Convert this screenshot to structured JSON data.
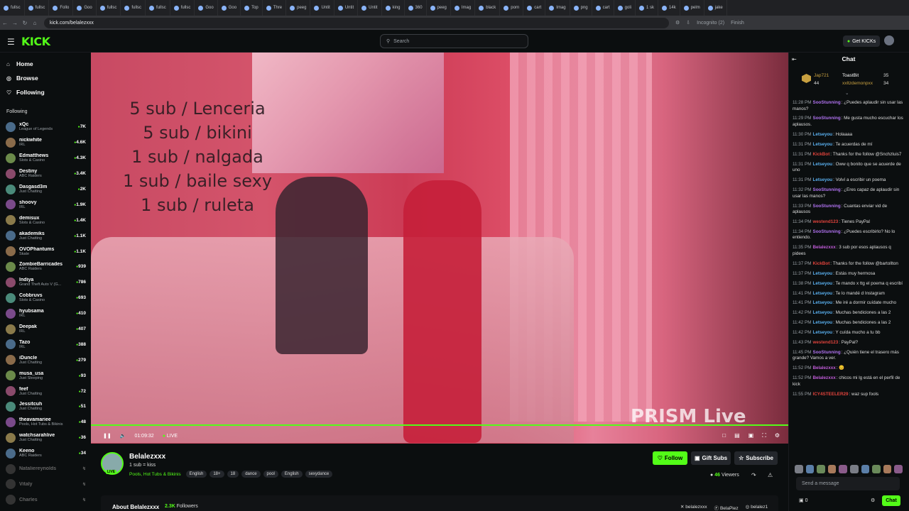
{
  "browser": {
    "tabs": [
      "fullsc",
      "fullsc",
      "Follo",
      "Goo",
      "fullsc",
      "fullsc",
      "fullsc",
      "fullsc",
      "Goo",
      "Goo",
      "Top",
      "Thre",
      "peeg",
      "Untit",
      "Untit",
      "Untit",
      "king",
      "360",
      "peeg",
      "Imag",
      "black",
      "porn",
      "cart",
      "Imag",
      "png",
      "cart",
      "goli",
      "1 sk",
      "14k",
      "pelm",
      "jake"
    ],
    "url": "kick.com/belalezxxx",
    "incognito": "Incognito (2)",
    "finish": "Finish"
  },
  "header": {
    "logo": "KICK",
    "search_placeholder": "Search",
    "get_kicks": "Get KICKs"
  },
  "sidebar": {
    "nav": [
      {
        "label": "Home",
        "icon": "home-icon"
      },
      {
        "label": "Browse",
        "icon": "compass-icon"
      },
      {
        "label": "Following",
        "icon": "heart-icon"
      }
    ],
    "following_label": "Following",
    "channels": [
      {
        "name": "xQc",
        "category": "League of Legends",
        "viewers": "7K"
      },
      {
        "name": "nickwhite",
        "category": "IRL",
        "viewers": "4.6K"
      },
      {
        "name": "Edmatthews",
        "category": "Slots & Casino",
        "viewers": "4.3K"
      },
      {
        "name": "Destiny",
        "category": "ABC Raiders",
        "viewers": "3.4K"
      },
      {
        "name": "Dasgasd3m",
        "category": "Just Chatting",
        "viewers": "2K"
      },
      {
        "name": "shoovy",
        "category": "IRL",
        "viewers": "1.9K"
      },
      {
        "name": "demisux",
        "category": "Slots & Casino",
        "viewers": "1.4K"
      },
      {
        "name": "akademiks",
        "category": "Just Chatting",
        "viewers": "1.1K"
      },
      {
        "name": "OVOPhantums",
        "category": "Skate",
        "viewers": "1.1K"
      },
      {
        "name": "ZombieBarricades",
        "category": "ABC Raiders",
        "viewers": "939"
      },
      {
        "name": "Indiya",
        "category": "Grand Theft Auto V (G...",
        "viewers": "786"
      },
      {
        "name": "Cobbruvs",
        "category": "Slots & Casino",
        "viewers": "693"
      },
      {
        "name": "hyubsama",
        "category": "IRL",
        "viewers": "410"
      },
      {
        "name": "Deepak",
        "category": "IRL",
        "viewers": "407"
      },
      {
        "name": "Tazo",
        "category": "IRL",
        "viewers": "388"
      },
      {
        "name": "iDuncle",
        "category": "Just Chatting",
        "viewers": "279"
      },
      {
        "name": "musa_usa",
        "category": "Just Sleeping",
        "viewers": "93"
      },
      {
        "name": "feef",
        "category": "Just Chatting",
        "viewers": "72"
      },
      {
        "name": "Jessitcuh",
        "category": "Just Chatting",
        "viewers": "51"
      },
      {
        "name": "theavamariee",
        "category": "Pools, Hot Tubs & Bikinis",
        "viewers": "48"
      },
      {
        "name": "watchsarahlive",
        "category": "Just Chatting",
        "viewers": "36"
      },
      {
        "name": "Keeno",
        "category": "ABC Raiders",
        "viewers": "34"
      }
    ],
    "offline_channels": [
      {
        "name": "Nataliereynolds",
        "status": "↯"
      },
      {
        "name": "Vitaly",
        "status": "↯"
      },
      {
        "name": "Charles",
        "status": "↯"
      }
    ]
  },
  "video": {
    "overlay_lines": [
      "5 sub / Lenceria",
      "5 sub / bikini",
      "1 sub / nalgada",
      "1 sub / baile sexy",
      "1 sub / ruleta"
    ],
    "watermark": "PRISM Live",
    "time": "01:09:32",
    "live": "LIVE",
    "progress": 1.0
  },
  "stream": {
    "streamer": "Belalezxxx",
    "title": "1 sub = kiss",
    "live_badge": "LIVE",
    "category": "Pools, Hot Tubs & Bikinis",
    "tags": [
      "English",
      "18+",
      "18",
      "dance",
      "pool",
      "English",
      "sexydance"
    ],
    "follow": "Follow",
    "gift_subs": "Gift Subs",
    "subscribe": "Subscribe",
    "viewers_count": "46",
    "viewers_label": "Viewers"
  },
  "about": {
    "title": "About Belalezxxx",
    "followers_count": "2.3K",
    "followers_label": "Followers",
    "socials": [
      "belalezxxx",
      "BelaPiez",
      "belalez1"
    ]
  },
  "chat": {
    "header": "Chat",
    "leaderboard": {
      "first_name": "Jap721",
      "first_count": "44",
      "second_name": "ToastBit",
      "second_count": "35",
      "third_name": "xxltzdemonpxx",
      "third_count": "34"
    },
    "messages": [
      {
        "time": "11:28 PM",
        "user": "SooStunning",
        "color": "#b072f0",
        "text": "¿Puedes aplaudir sin usar las manos?"
      },
      {
        "time": "11:29 PM",
        "user": "SooStunning",
        "color": "#b072f0",
        "text": "Me gusta mucho escuchar los aplausos."
      },
      {
        "time": "11:30 PM",
        "user": "Letseyou",
        "color": "#5ab0f0",
        "text": "Holaaaa"
      },
      {
        "time": "11:31 PM",
        "user": "Letseyou",
        "color": "#5ab0f0",
        "text": "Te acuerdas de mí"
      },
      {
        "time": "11:31 PM",
        "user": "KickBot",
        "color": "#e0433c",
        "text": "Thanks for the follow @Snchzluis7"
      },
      {
        "time": "11:31 PM",
        "user": "Letseyou",
        "color": "#5ab0f0",
        "text": "Oww q bonito que se acuerde de uno"
      },
      {
        "time": "11:31 PM",
        "user": "Letseyou",
        "color": "#5ab0f0",
        "text": "Volví a escribir un poema"
      },
      {
        "time": "11:32 PM",
        "user": "SooStunning",
        "color": "#b072f0",
        "text": "¿Eres capaz de aplaudir sin usar las manos?"
      },
      {
        "time": "11:33 PM",
        "user": "SooStunning",
        "color": "#b072f0",
        "text": "Cuantas enviar vid de aplausos"
      },
      {
        "time": "11:34 PM",
        "user": "westend123",
        "color": "#e0433c",
        "text": "Tienes PayPal"
      },
      {
        "time": "11:34 PM",
        "user": "SooStunning",
        "color": "#b072f0",
        "text": "¿Puedes escribirlo? No lo entiendo."
      },
      {
        "time": "11:35 PM",
        "user": "Belalezxxx",
        "color": "#c05cd8",
        "text": "3 sub por esos aplausos q pidees"
      },
      {
        "time": "11:37 PM",
        "user": "KickBot",
        "color": "#e0433c",
        "text": "Thanks for the follow @bartollton"
      },
      {
        "time": "11:37 PM",
        "user": "Letseyou",
        "color": "#5ab0f0",
        "text": "Estás muy hermosa"
      },
      {
        "time": "11:38 PM",
        "user": "Letseyou",
        "color": "#5ab0f0",
        "text": "Te mando x ttg el poema q escribí"
      },
      {
        "time": "11:41 PM",
        "user": "Letseyou",
        "color": "#5ab0f0",
        "text": "Te lo mandé d Instagram"
      },
      {
        "time": "11:41 PM",
        "user": "Letseyou",
        "color": "#5ab0f0",
        "text": "Me iré a dormir cuídate mucho"
      },
      {
        "time": "11:42 PM",
        "user": "Letseyou",
        "color": "#5ab0f0",
        "text": "Muchas bendiciones a las 2"
      },
      {
        "time": "11:42 PM",
        "user": "Letseyou",
        "color": "#5ab0f0",
        "text": "Muchas bendiciones a las 2"
      },
      {
        "time": "11:42 PM",
        "user": "Letseyou",
        "color": "#5ab0f0",
        "text": "Y cuída mucho a tu bb"
      },
      {
        "time": "11:43 PM",
        "user": "westend123",
        "color": "#e0433c",
        "text": "PayPal?"
      },
      {
        "time": "11:45 PM",
        "user": "SooStunning",
        "color": "#b072f0",
        "text": "¿Quién tiene el trasero más grande? Vamos a ver."
      },
      {
        "time": "11:52 PM",
        "user": "Belalezxxx",
        "color": "#c05cd8",
        "text": "😊"
      },
      {
        "time": "11:52 PM",
        "user": "Belalezxxx",
        "color": "#c05cd8",
        "text": "chicos mi lg está en el perfil de kick"
      },
      {
        "time": "11:55 PM",
        "user": "ICY4STEELER29",
        "color": "#e0433c",
        "text": "waz sup fools"
      }
    ],
    "input_placeholder": "Send a message",
    "points": "0",
    "send": "Chat"
  },
  "colors": {
    "accent": "#53fc18",
    "bg": "#0b0e0f"
  }
}
